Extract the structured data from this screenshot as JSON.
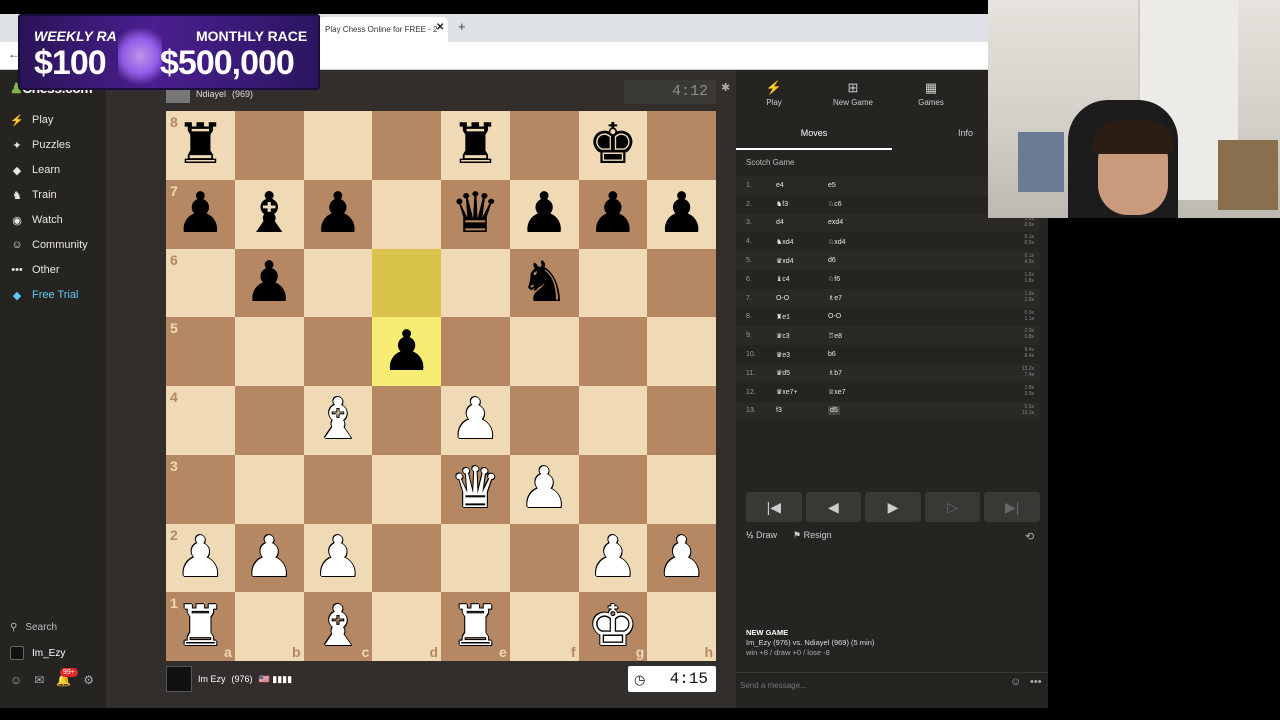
{
  "browser": {
    "tab_title": "Play Chess Online for FREE - 2",
    "tab_close": "✕",
    "new_tab": "+",
    "back": "←"
  },
  "banner": {
    "weekly_label": "WEEKLY RA",
    "weekly_amount": "$100",
    "monthly_label": "MONTHLY RACE",
    "monthly_amount": "$500,000"
  },
  "sidebar": {
    "logo_glyph": "♟",
    "logo_text": "Chess.com",
    "items": [
      {
        "label": "Play",
        "icon": "⚡",
        "icon_name": "play-icon"
      },
      {
        "label": "Puzzles",
        "icon": "✦",
        "icon_name": "puzzle-icon"
      },
      {
        "label": "Learn",
        "icon": "◆",
        "icon_name": "learn-icon"
      },
      {
        "label": "Train",
        "icon": "♞",
        "icon_name": "train-icon"
      },
      {
        "label": "Watch",
        "icon": "◉",
        "icon_name": "watch-icon"
      },
      {
        "label": "Community",
        "icon": "☺",
        "icon_name": "community-icon"
      },
      {
        "label": "Other",
        "icon": "•••",
        "icon_name": "more-icon"
      },
      {
        "label": "Free Trial",
        "icon": "◆",
        "icon_name": "diamond-icon"
      }
    ],
    "search_label": "Search",
    "username": "Im_Ezy",
    "notif_count": "99+"
  },
  "opponent": {
    "name": "Ndiayel",
    "rating": "(969)",
    "clock": "4:12"
  },
  "player": {
    "name": "Im Ezy",
    "rating": "(976)",
    "flags": "🇺🇸 ▮▮▮▮",
    "clock": "4:15"
  },
  "board": {
    "light": "#f0d9b5",
    "dark": "#b58863",
    "highlight_squares": [
      "d6",
      "d5"
    ],
    "ranks": [
      "8",
      "7",
      "6",
      "5",
      "4",
      "3",
      "2",
      "1"
    ],
    "files": [
      "a",
      "b",
      "c",
      "d",
      "e",
      "f",
      "g",
      "h"
    ],
    "position": [
      [
        "r",
        "",
        "",
        "",
        "r",
        "",
        "k",
        ""
      ],
      [
        "p",
        "b",
        "p",
        "",
        "q",
        "p",
        "p",
        "p"
      ],
      [
        "",
        "p",
        "",
        "",
        "",
        "n",
        "",
        ""
      ],
      [
        "",
        "",
        "",
        "p",
        "",
        "",
        "",
        ""
      ],
      [
        "",
        "",
        "B",
        "",
        "P",
        "",
        "",
        ""
      ],
      [
        "",
        "",
        "",
        "",
        "Q",
        "P",
        "",
        ""
      ],
      [
        "P",
        "P",
        "P",
        "",
        "",
        "",
        "P",
        "P"
      ],
      [
        "R",
        "",
        "B",
        "",
        "R",
        "",
        "K",
        ""
      ]
    ]
  },
  "panel": {
    "tabs": [
      {
        "label": "Play",
        "icon": "⚡",
        "icon_name": "bolt-icon"
      },
      {
        "label": "New Game",
        "icon": "⊞",
        "icon_name": "plus-box-icon"
      },
      {
        "label": "Games",
        "icon": "▦",
        "icon_name": "games-icon"
      }
    ],
    "subtabs": {
      "moves": "Moves",
      "info": "Info"
    },
    "opening": "Scotch Game",
    "moves": [
      {
        "n": "1.",
        "w": "e4",
        "b": "e5",
        "t": ""
      },
      {
        "n": "2.",
        "w": "♞f3",
        "b": "♘c6",
        "t": ""
      },
      {
        "n": "3.",
        "w": "d4",
        "b": "exd4",
        "t": "1.2s\n0.5s"
      },
      {
        "n": "4.",
        "w": "♞xd4",
        "b": "♘xd4",
        "t": "0.1s\n0.5s"
      },
      {
        "n": "5.",
        "w": "♛xd4",
        "b": "d6",
        "t": "0.1s\n4.0s"
      },
      {
        "n": "6.",
        "w": "♝c4",
        "b": "♘f6",
        "t": "1.6s\n1.8s"
      },
      {
        "n": "7.",
        "w": "O-O",
        "b": "♗e7",
        "t": "1.0s\n1.5s"
      },
      {
        "n": "8.",
        "w": "♜e1",
        "b": "O-O",
        "t": "0.9s\n1.1s"
      },
      {
        "n": "9.",
        "w": "♛c3",
        "b": "♖e8",
        "t": "2.0s\n0.8s"
      },
      {
        "n": "10.",
        "w": "♛e3",
        "b": "b6",
        "t": "9.4s\n8.4s"
      },
      {
        "n": "11.",
        "w": "♛d5",
        "b": "♗b7",
        "t": "13.2s\n7.4s"
      },
      {
        "n": "12.",
        "w": "♛xe7+",
        "b": "♕xe7",
        "t": "2.8s\n3.9s"
      },
      {
        "n": "13.",
        "w": "f3",
        "b": "d5",
        "t": "5.5s\n13.1s"
      }
    ],
    "controls": [
      {
        "glyph": "|◀",
        "name": "first-move-button"
      },
      {
        "glyph": "◀",
        "name": "prev-move-button"
      },
      {
        "glyph": "▶",
        "name": "play-button"
      },
      {
        "glyph": "▷",
        "name": "next-move-button"
      },
      {
        "glyph": "▶|",
        "name": "last-move-button"
      }
    ],
    "draw_label": "Draw",
    "resign_label": "Resign",
    "new_game_heading": "NEW GAME",
    "new_game_line": "Im_Ezy (976) vs. Ndiayel (969) (5 min)",
    "new_game_record": "win +8 / draw +0 / lose -8",
    "message_placeholder": "Send a message..."
  }
}
